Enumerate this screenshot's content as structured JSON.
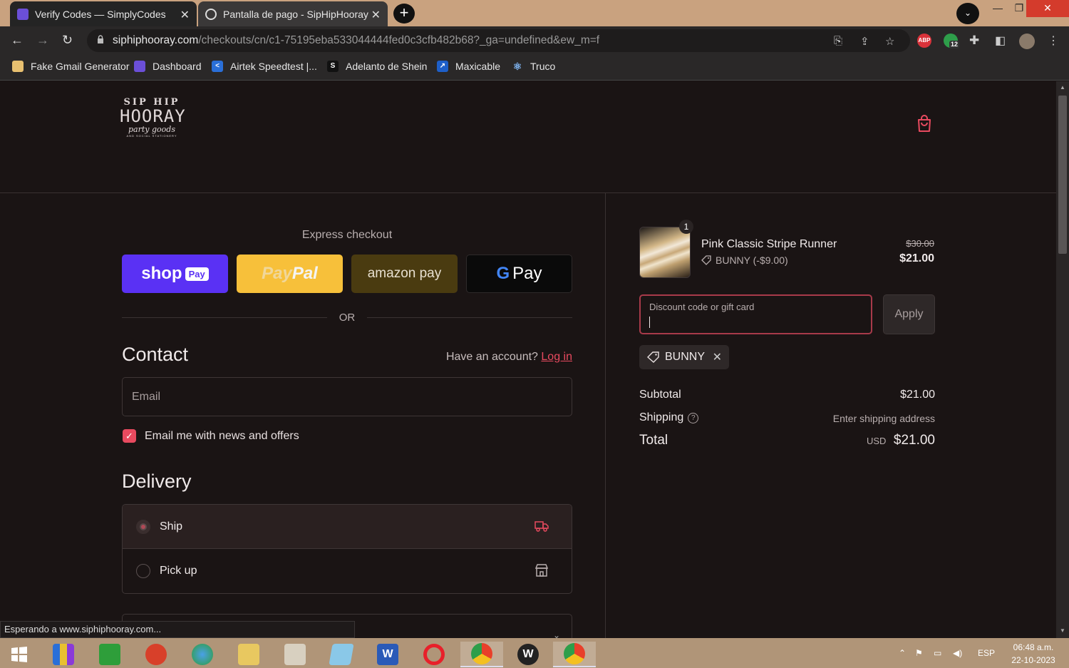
{
  "browser": {
    "tabs": [
      {
        "title": "Verify Codes — SimplyCodes",
        "active": false
      },
      {
        "title": "Pantalla de pago - SipHipHooray",
        "active": true
      }
    ],
    "url_host": "siphiphooray.com",
    "url_path": "/checkouts/cn/c1-75195eba533044444fed0c3cfb482b68?_ga=undefined&ew_m=f",
    "extension_badge": "12",
    "abp_label": "ABP",
    "bookmarks": [
      {
        "label": "Fake Gmail Generator"
      },
      {
        "label": "Dashboard"
      },
      {
        "label": "Airtek Speedtest |..."
      },
      {
        "label": "Adelanto de Shein"
      },
      {
        "label": "Maxicable"
      },
      {
        "label": "Truco"
      }
    ],
    "status_text": "Esperando a www.siphiphooray.com..."
  },
  "store": {
    "logo_line1": "SIP HIP",
    "logo_line2": "HOORAY",
    "logo_line3": "party goods",
    "logo_line4": "AND SOCIAL STATIONERY"
  },
  "checkout": {
    "express_label": "Express checkout",
    "shop_pay": {
      "word": "shop",
      "badge": "Pay"
    },
    "paypal": {
      "part1": "Pay",
      "part2": "Pal"
    },
    "amazon_pay": "amazon pay",
    "gpay": {
      "g": "G",
      "text": "Pay"
    },
    "or_text": "OR",
    "contact_title": "Contact",
    "have_account": "Have an account?",
    "login_link": "Log in",
    "email_placeholder": "Email",
    "news_checkbox": {
      "label": "Email me with news and offers",
      "checked": true
    },
    "delivery_title": "Delivery",
    "delivery_options": [
      {
        "label": "Ship",
        "selected": true,
        "icon": "truck-icon"
      },
      {
        "label": "Pick up",
        "selected": false,
        "icon": "store-icon"
      }
    ]
  },
  "summary": {
    "item": {
      "quantity": "1",
      "name": "Pink Classic Stripe Runner",
      "discount": "BUNNY (-$9.00)",
      "original_price": "$30.00",
      "price": "$21.00"
    },
    "discount_label": "Discount code or gift card",
    "apply_label": "Apply",
    "applied_code": "BUNNY",
    "subtotal_label": "Subtotal",
    "subtotal_value": "$21.00",
    "shipping_label": "Shipping",
    "shipping_value": "Enter shipping address",
    "total_label": "Total",
    "total_currency": "USD",
    "total_value": "$21.00"
  },
  "taskbar": {
    "lang": "ESP",
    "time": "06:48 a.m.",
    "date": "22-10-2023"
  },
  "colors": {
    "accent": "#e84a5f",
    "shop_pay": "#5a31f4",
    "paypal": "#f7c03a",
    "background": "#1a1414"
  }
}
